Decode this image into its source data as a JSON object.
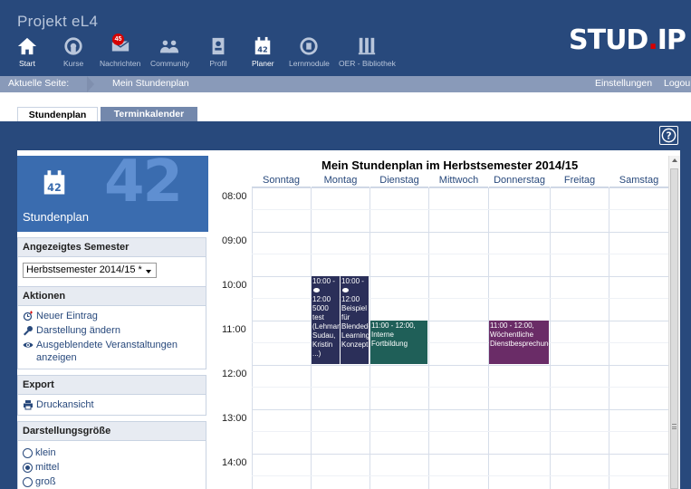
{
  "app": {
    "title": "Projekt eL4"
  },
  "nav": [
    {
      "label": "Start",
      "icon": "home-icon"
    },
    {
      "label": "Kurse",
      "icon": "courses-icon"
    },
    {
      "label": "Nachrichten",
      "icon": "mail-icon",
      "badge": "45"
    },
    {
      "label": "Community",
      "icon": "community-icon"
    },
    {
      "label": "Profil",
      "icon": "profile-icon"
    },
    {
      "label": "Planer",
      "icon": "planner-icon"
    },
    {
      "label": "Lernmodule",
      "icon": "modules-icon"
    },
    {
      "label": "OER - Bibliothek",
      "icon": "library-icon"
    }
  ],
  "logo": {
    "text": "STUD",
    "dot": ".",
    "suffix": "IP"
  },
  "breadcrumb": {
    "label": "Aktuelle Seite:",
    "page": "Mein Stundenplan",
    "settings": "Einstellungen",
    "logout": "Logou"
  },
  "tabs": {
    "schedule": "Stundenplan",
    "calendar": "Terminkalender"
  },
  "sidebar": {
    "head_number": "42",
    "head_title": "Stundenplan",
    "semester_title": "Angezeigtes Semester",
    "semester_value": "Herbstsemester 2014/15 *",
    "actions_title": "Aktionen",
    "actions": [
      "Neuer Eintrag",
      "Darstellung ändern",
      "Ausgeblendete Veranstaltungen anzeigen"
    ],
    "export_title": "Export",
    "export_print": "Druckansicht",
    "size_title": "Darstellungsgröße",
    "sizes": [
      "klein",
      "mittel",
      "groß"
    ],
    "size_selected": "mittel"
  },
  "calendar": {
    "title": "Mein Stundenplan im Herbstsemester 2014/15",
    "days": [
      "Sonntag",
      "Montag",
      "Dienstag",
      "Mittwoch",
      "Donnerstag",
      "Freitag",
      "Samstag"
    ],
    "hours": [
      "08:00",
      "09:00",
      "10:00",
      "11:00",
      "12:00",
      "13:00",
      "14:00"
    ],
    "events": [
      {
        "time1": "10:00 -",
        "time2": "12:00",
        "text": "5000 test (Lehmann, Sudau, Kristin ...)",
        "color": "#2b2f59"
      },
      {
        "time1": "10:00 -",
        "time2": "12:00",
        "text": "Beispiel für Blended-Learning-Konzept",
        "color": "#2b2f59"
      },
      {
        "time1": "11:00 - 12:00,",
        "time2": "",
        "text": "Interne Fortbildung",
        "color": "#1f5f58"
      },
      {
        "time1": "11:00 - 12:00,",
        "time2": "",
        "text": "Wöchentliche Dienstbesprechung",
        "color": "#6a2c67"
      }
    ]
  },
  "colors": {
    "header": "#28497c",
    "crumb": "#899ab9",
    "accent": "#d60000"
  }
}
